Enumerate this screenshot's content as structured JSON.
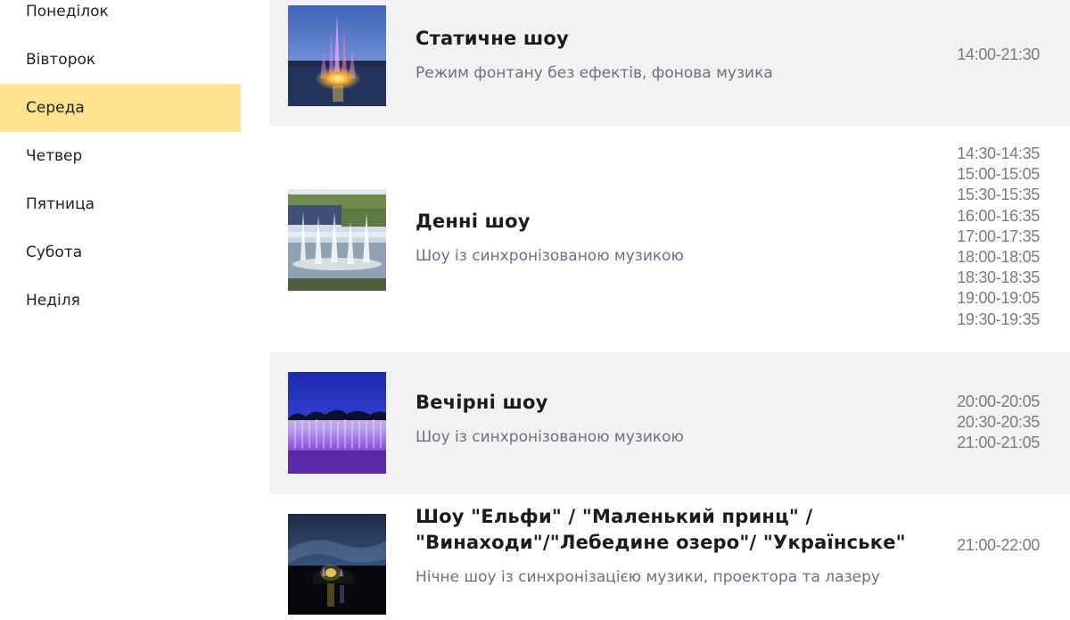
{
  "days": [
    {
      "label": "Понеділок"
    },
    {
      "label": "Вівторок"
    },
    {
      "label": "Середа",
      "active": true
    },
    {
      "label": "Четвер"
    },
    {
      "label": "Пятница"
    },
    {
      "label": "Субота"
    },
    {
      "label": "Неділя"
    }
  ],
  "shows": [
    {
      "title": "Статичне шоу",
      "description": "Режим фонтану без ефектів, фонова музика",
      "times": [
        "14:00-21:30"
      ],
      "image": "fountain-night-colored-photo"
    },
    {
      "title": "Денні шоу",
      "description": "Шоу із синхронізованою музикою",
      "times": [
        "14:30-14:35",
        "15:00-15:05",
        "15:30-15:35",
        "16:00-16:35",
        "17:00-17:35",
        "18:00-18:05",
        "18:30-18:35",
        "19:00-19:05",
        "19:30-19:35"
      ],
      "image": "fountain-daytime-photo"
    },
    {
      "title": "Вечірні шоу",
      "description": "Шоу із синхронізованою музикою",
      "times": [
        "20:00-20:05",
        "20:30-20:35",
        "21:00-21:05"
      ],
      "image": "fountain-evening-purple-photo"
    },
    {
      "title": "Шоу \"Ельфи\" / \"Маленький принц\" / \"Винаходи\"/\"Лебедине озеро\"/ \"Українське\"",
      "description": "Нічне шоу із синхронізацією музики, проектора та лазеру",
      "times": [
        "21:00-22:00"
      ],
      "image": "fountain-night-laser-photo"
    }
  ],
  "colors": {
    "active_day_bg": "#fde28f",
    "row_shade": "#f2f2f3",
    "description_text": "#6e6e84",
    "time_text": "#7a7a80"
  }
}
